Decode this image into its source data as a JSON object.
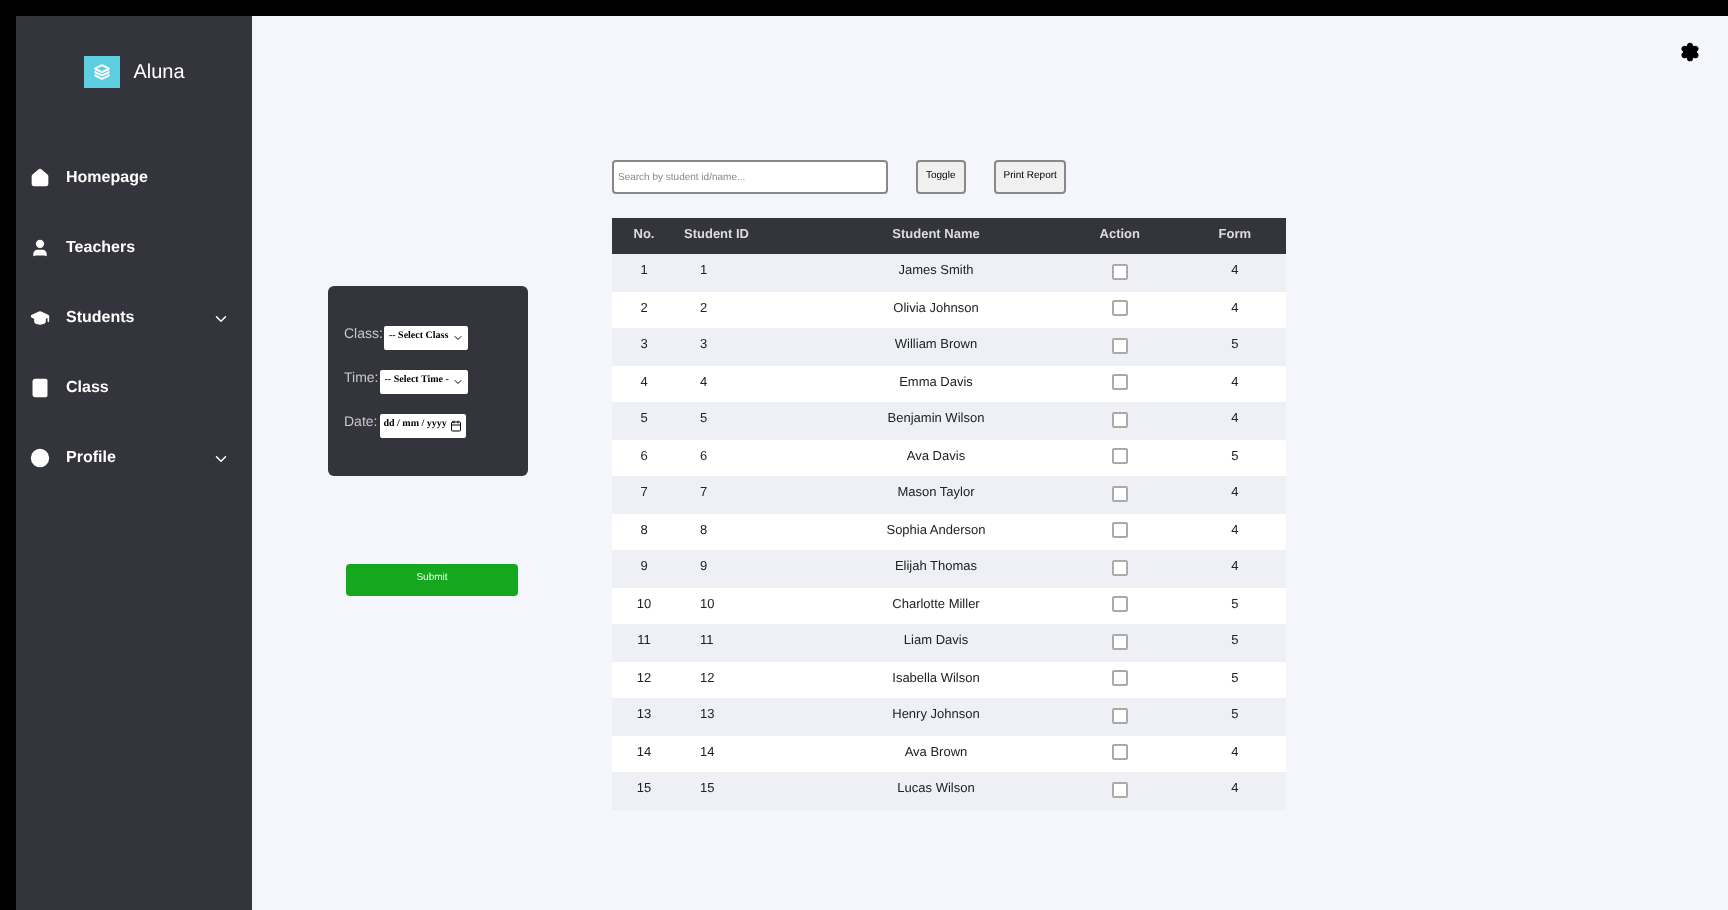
{
  "sidebar": {
    "brand": "Aluna",
    "items": [
      {
        "label": "Homepage",
        "expandable": false
      },
      {
        "label": "Teachers",
        "expandable": false
      },
      {
        "label": "Students",
        "expandable": true
      },
      {
        "label": "Class",
        "expandable": false
      },
      {
        "label": "Profile",
        "expandable": true
      }
    ]
  },
  "filter_form": {
    "fields": [
      {
        "label": "Class:",
        "kind": "select",
        "value": "-- Select Class"
      },
      {
        "label": "Time:",
        "kind": "select",
        "value": "-- Select Time -"
      },
      {
        "label": "Date:",
        "kind": "date",
        "value": "dd / mm / yyyy"
      }
    ],
    "submit": "Submit"
  },
  "toolbar": {
    "search": {
      "placeholder": "Search by student id/name..."
    },
    "buttons": [
      "Toggle",
      "Print Report"
    ]
  },
  "table": {
    "columns": [
      "No.",
      "Student ID",
      "Student Name",
      "Action",
      "Form"
    ],
    "rows": [
      {
        "no": "1",
        "id": "1",
        "name": "James Smith",
        "checked": false,
        "form": "4"
      },
      {
        "no": "2",
        "id": "2",
        "name": "Olivia Johnson",
        "checked": false,
        "form": "4"
      },
      {
        "no": "3",
        "id": "3",
        "name": "William Brown",
        "checked": false,
        "form": "5"
      },
      {
        "no": "4",
        "id": "4",
        "name": "Emma Davis",
        "checked": false,
        "form": "4"
      },
      {
        "no": "5",
        "id": "5",
        "name": "Benjamin Wilson",
        "checked": false,
        "form": "4"
      },
      {
        "no": "6",
        "id": "6",
        "name": "Ava Davis",
        "checked": false,
        "form": "5"
      },
      {
        "no": "7",
        "id": "7",
        "name": "Mason Taylor",
        "checked": false,
        "form": "4"
      },
      {
        "no": "8",
        "id": "8",
        "name": "Sophia Anderson",
        "checked": false,
        "form": "4"
      },
      {
        "no": "9",
        "id": "9",
        "name": "Elijah Thomas",
        "checked": false,
        "form": "4"
      },
      {
        "no": "10",
        "id": "10",
        "name": "Charlotte Miller",
        "checked": false,
        "form": "5"
      },
      {
        "no": "11",
        "id": "11",
        "name": "Liam Davis",
        "checked": false,
        "form": "5"
      },
      {
        "no": "12",
        "id": "12",
        "name": "Isabella Wilson",
        "checked": false,
        "form": "5"
      },
      {
        "no": "13",
        "id": "13",
        "name": "Henry Johnson",
        "checked": false,
        "form": "5"
      },
      {
        "no": "14",
        "id": "14",
        "name": "Ava Brown",
        "checked": false,
        "form": "4"
      },
      {
        "no": "15",
        "id": "15",
        "name": "Lucas Wilson",
        "checked": false,
        "form": "4"
      }
    ]
  }
}
